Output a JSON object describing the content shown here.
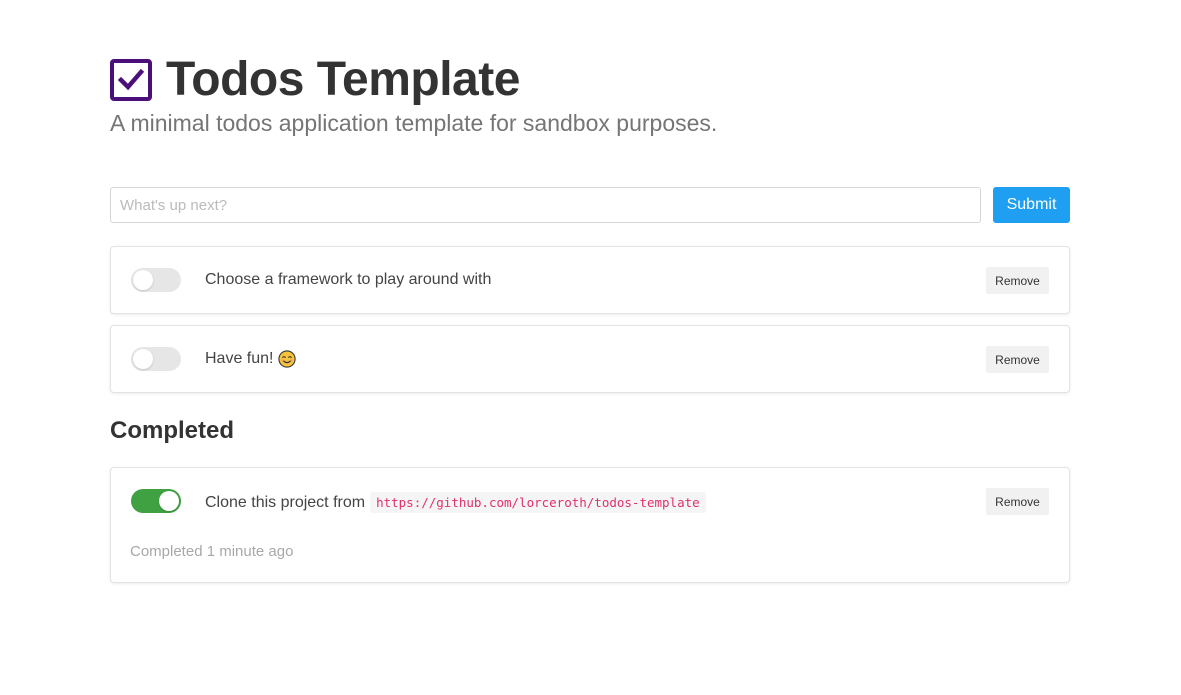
{
  "header": {
    "title": "Todos Template",
    "subtitle": "A minimal todos application template for sandbox purposes.",
    "logo_icon": "checkbox-checked-icon",
    "logo_color": "#4b0f7a"
  },
  "form": {
    "placeholder": "What's up next?",
    "value": "",
    "submit_label": "Submit",
    "submit_color": "#1e9ff2"
  },
  "todos": [
    {
      "text": "Choose a framework to play around with",
      "done": false,
      "remove_label": "Remove"
    },
    {
      "text": "Have fun!",
      "emoji_icon": "smiling-face-icon",
      "done": false,
      "remove_label": "Remove"
    }
  ],
  "completed": {
    "heading": "Completed",
    "items": [
      {
        "text": "Clone this project from",
        "link": "https://github.com/lorceroth/todos-template",
        "done": true,
        "completed_label": "Completed 1 minute ago",
        "remove_label": "Remove"
      }
    ]
  },
  "colors": {
    "toggle_on": "#3fa142",
    "toggle_off": "#e6e6e6",
    "code_text": "#e0306e"
  }
}
